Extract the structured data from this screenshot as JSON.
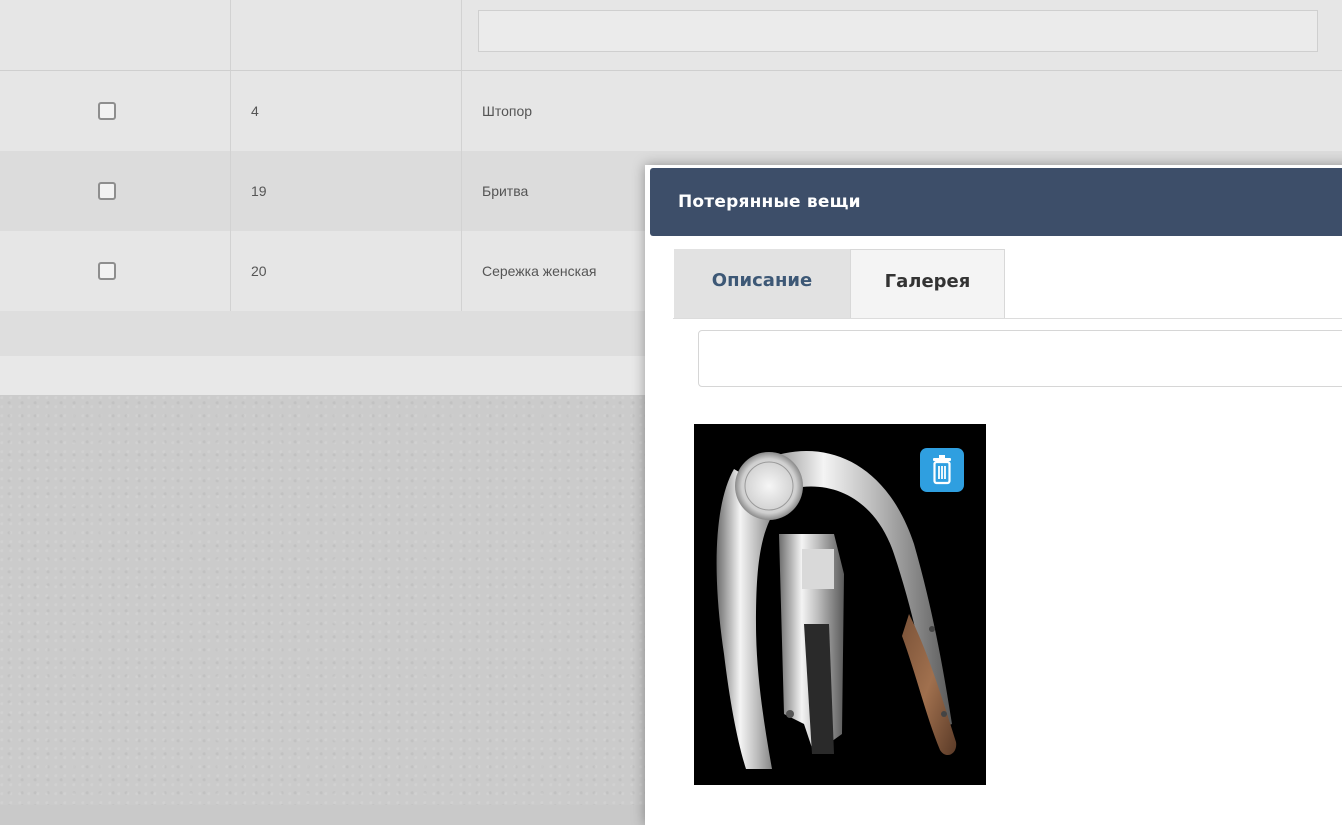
{
  "table": {
    "rows": [
      {
        "id": "4",
        "name": "Штопор"
      },
      {
        "id": "19",
        "name": "Бритва"
      },
      {
        "id": "20",
        "name": "Сережка женская"
      }
    ]
  },
  "modal": {
    "title": "Потерянные вещи",
    "tabs": [
      {
        "label": "Описание"
      },
      {
        "label": "Галерея"
      }
    ],
    "gallery": {
      "items": [
        {
          "image": "corkscrew-photo",
          "action_icon": "trash-icon"
        }
      ]
    }
  },
  "colors": {
    "header_bg": "#3d4e69",
    "tab_active_text": "#3d5876",
    "delete_button": "#2f9fe0"
  }
}
